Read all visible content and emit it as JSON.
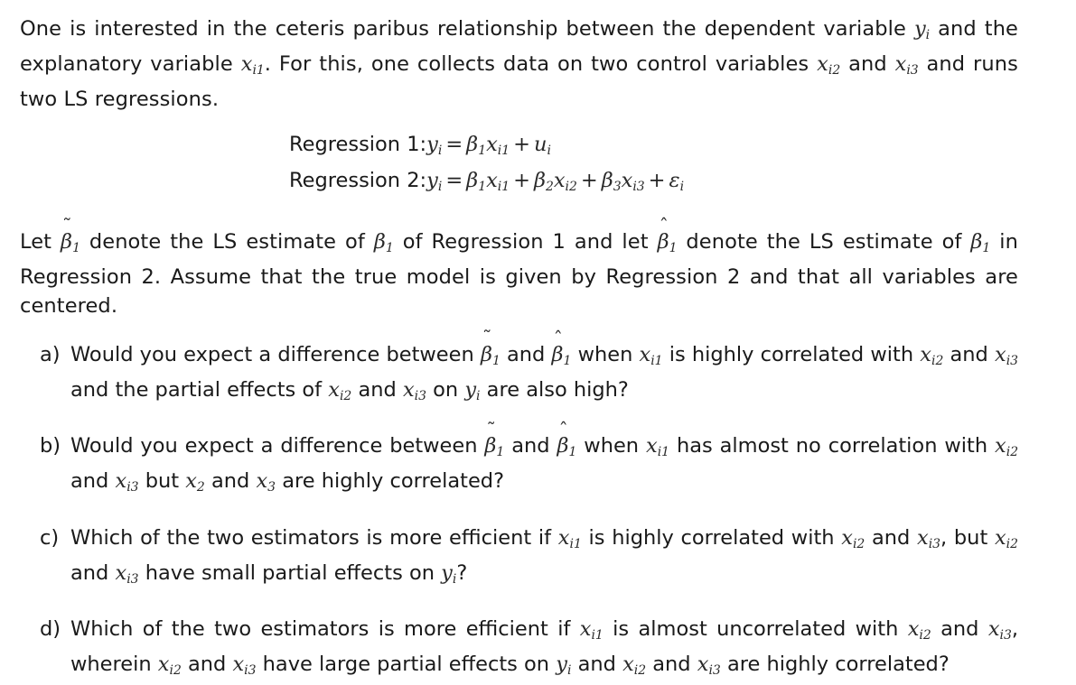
{
  "document": {
    "type": "econometrics-exercise",
    "background_color": "#ffffff",
    "text_color": "#1a1a1a",
    "intro": {
      "segments": [
        {
          "t": "text",
          "v": "One is interested in the ceteris paribus relationship between the dependent variable "
        },
        {
          "t": "math",
          "base": "y",
          "sub": "i"
        },
        {
          "t": "text",
          "v": " and the explanatory variable "
        },
        {
          "t": "math",
          "base": "x",
          "sub": "i1"
        },
        {
          "t": "text",
          "v": ". For this, one collects data on two control variables "
        },
        {
          "t": "math",
          "base": "x",
          "sub": "i2"
        },
        {
          "t": "text",
          "v": " and "
        },
        {
          "t": "math",
          "base": "x",
          "sub": "i3"
        },
        {
          "t": "text",
          "v": " and runs two LS regressions."
        }
      ],
      "plain": "One is interested in the ceteris paribus relationship between the dependent variable y_i and the explanatory variable x_i1. For this, one collects data on two control variables x_i2 and x_i3 and runs two LS regressions."
    },
    "equations": [
      {
        "label": "Regression 1:",
        "body_plain": "y_i = β_1 x_i1 + u_i"
      },
      {
        "label": "Regression 2:",
        "body_plain": "y_i = β_1 x_i1 + β_2 x_i2 + β_3 x_i3 + ε_i"
      }
    ],
    "let_paragraph": {
      "plain": "Let β̃_1 denote the LS estimate of β_1 of Regression 1 and let β̂_1 denote the LS estimate of β_1 in Regression 2. Assume that the true model is given by Regression 2 and that all variables are centered."
    },
    "questions": [
      {
        "marker": "a)",
        "plain": "Would you expect a difference between β̃_1 and β̂_1 when x_i1 is highly correlated with x_i2 and x_i3 and the partial effects of x_i2 and x_i3 on y_i are also high?"
      },
      {
        "marker": "b)",
        "plain": "Would you expect a difference between β̃_1 and β̂_1 when x_i1 has almost no correlation with x_i2 and x_i3 but x_2 and x_3 are highly correlated?"
      },
      {
        "marker": "c)",
        "plain": "Which of the two estimators is more efficient if x_i1 is highly correlated with x_i2 and x_i3, but x_i2 and x_i3 have small partial effects on y_i?"
      },
      {
        "marker": "d)",
        "plain": "Which of the two estimators is more efficient if x_i1 is almost uncorrelated with x_i2 and x_i3, wherein x_i2 and x_i3 have large partial effects on y_i and x_i2 and x_i3 are highly correlated?"
      }
    ],
    "text": {
      "intro_1": "One is interested in the ceteris paribus relationship between the dependent variable",
      "intro_2": "and the explanatory variable",
      "intro_3": ". For this, one collects data on two control variables",
      "intro_4": "and",
      "intro_5": "and runs two LS regressions.",
      "eq1_label": "Regression 1:",
      "eq2_label": "Regression 2:",
      "let_1": "Let",
      "let_2": "denote the LS estimate of",
      "let_3": "of Regression 1 and let",
      "let_4": "denote the LS estimate of",
      "let_5": "in Regression 2. Assume that the true model is given by Regression 2 and that all variables are centered.",
      "a_marker": "a)",
      "a_1": "Would you expect a difference between",
      "a_2": "and",
      "a_3": "when",
      "a_4": "is highly correlated with",
      "a_5": "and",
      "a_6": "and the partial effects of",
      "a_7": "and",
      "a_8": "on",
      "a_9": "are also high?",
      "b_marker": "b)",
      "b_1": "Would you expect a difference between",
      "b_2": "and",
      "b_3": "when",
      "b_4": "has almost no correlation with",
      "b_5": "and",
      "b_6": "but",
      "b_7": "and",
      "b_8": "are highly correlated?",
      "c_marker": "c)",
      "c_1": "Which of the two estimators is more efficient if",
      "c_2": "is highly correlated with",
      "c_3": "and",
      "c_4": ", but",
      "c_5": "and",
      "c_6": "have small partial effects on",
      "c_7": "?",
      "d_marker": "d)",
      "d_1": "Which of the two estimators is more efficient if",
      "d_2": "is almost uncorrelated with",
      "d_3": "and",
      "d_4": ", wherein",
      "d_5": "and",
      "d_6": "have large partial effects on",
      "d_7": "and",
      "d_8": "and",
      "d_9": "are highly correlated?"
    },
    "symbols": {
      "y": "y",
      "x": "x",
      "u": "u",
      "beta": "β",
      "epsilon": "ε",
      "tilde": "˜",
      "hat": "ˆ",
      "equals": "=",
      "plus": "+",
      "sub_i": "i",
      "sub_i1": "i1",
      "sub_i2": "i2",
      "sub_i3": "i3",
      "sub_1": "1",
      "sub_2": "2",
      "sub_3": "3"
    }
  }
}
